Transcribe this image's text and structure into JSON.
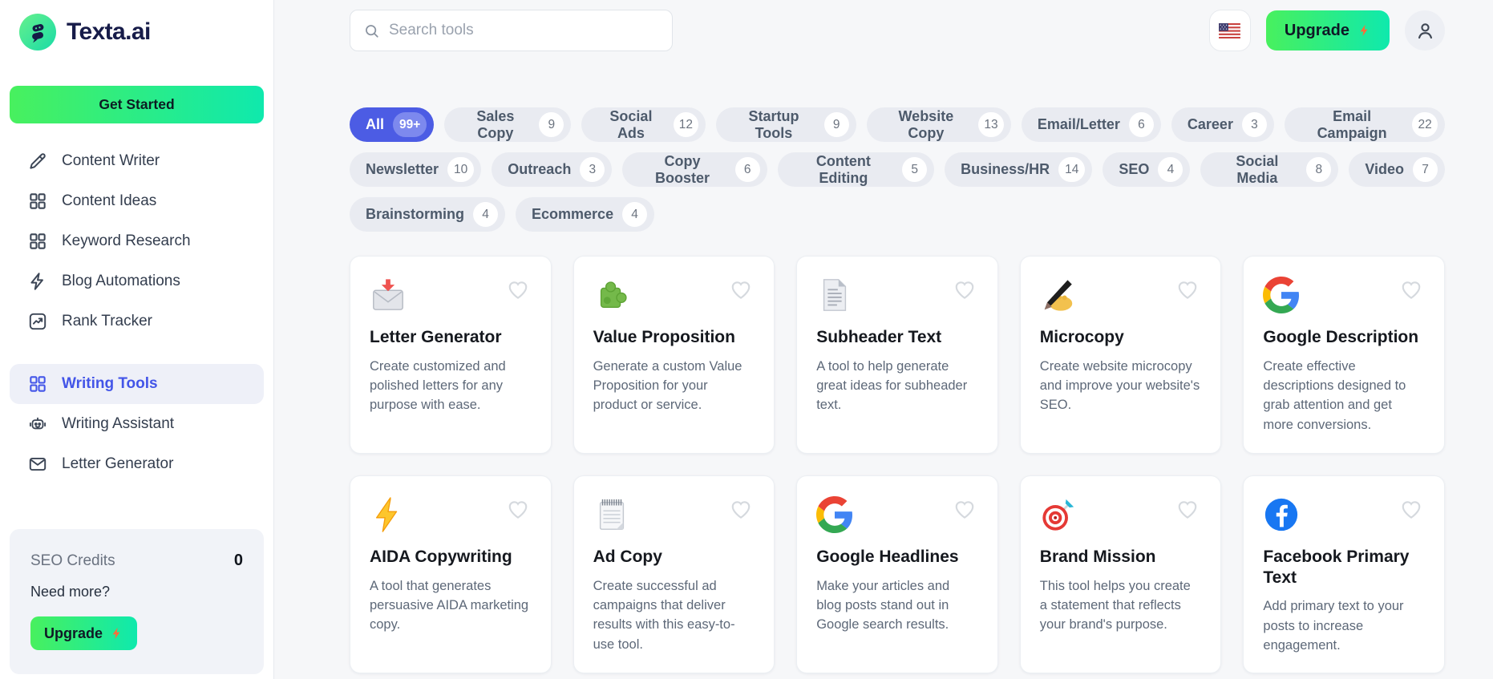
{
  "brand": {
    "name": "Texta.ai",
    "logo_icon": "chat-bubbles-icon"
  },
  "colors": {
    "accent_gradient_start": "#48f05e",
    "accent_gradient_end": "#0fe9ad",
    "active_indigo": "#4c5ce4",
    "bolt_orange": "#fb6d3a",
    "sidebar_active_bg": "#eef0f8",
    "pill_bg": "#e9ebf1",
    "main_bg": "#f6f7f9"
  },
  "sidebar": {
    "get_started_label": "Get Started",
    "items": [
      {
        "label": "Content Writer",
        "icon": "pencil-icon",
        "active": false,
        "group_start": false
      },
      {
        "label": "Content Ideas",
        "icon": "grid-icon",
        "active": false,
        "group_start": false
      },
      {
        "label": "Keyword Research",
        "icon": "grid-icon",
        "active": false,
        "group_start": false
      },
      {
        "label": "Blog Automations",
        "icon": "bolt-outline-icon",
        "active": false,
        "group_start": false
      },
      {
        "label": "Rank Tracker",
        "icon": "chart-icon",
        "active": false,
        "group_start": false
      },
      {
        "label": "Writing Tools",
        "icon": "grid-icon",
        "active": true,
        "group_start": true
      },
      {
        "label": "Writing Assistant",
        "icon": "robot-icon",
        "active": false,
        "group_start": false
      },
      {
        "label": "Letter Generator",
        "icon": "envelope-icon",
        "active": false,
        "group_start": false
      }
    ],
    "credits": {
      "label": "SEO Credits",
      "value": "0",
      "need_more": "Need more?",
      "upgrade_label": "Upgrade",
      "upgrade_icon": "bolt-fill-icon"
    }
  },
  "header": {
    "search_placeholder": "Search tools",
    "search_icon": "search-icon",
    "language_icon": "us-flag-icon",
    "upgrade_label": "Upgrade",
    "upgrade_icon": "bolt-fill-icon",
    "avatar_icon": "user-icon"
  },
  "filters": {
    "rows": [
      [
        {
          "label": "All",
          "count": "99+",
          "active": true
        },
        {
          "label": "Sales Copy",
          "count": "9",
          "active": false
        },
        {
          "label": "Social Ads",
          "count": "12",
          "active": false
        },
        {
          "label": "Startup Tools",
          "count": "9",
          "active": false
        },
        {
          "label": "Website Copy",
          "count": "13",
          "active": false
        },
        {
          "label": "Email/Letter",
          "count": "6",
          "active": false
        },
        {
          "label": "Career",
          "count": "3",
          "active": false
        },
        {
          "label": "Email Campaign",
          "count": "22",
          "active": false
        }
      ],
      [
        {
          "label": "Newsletter",
          "count": "10",
          "active": false
        },
        {
          "label": "Outreach",
          "count": "3",
          "active": false
        },
        {
          "label": "Copy Booster",
          "count": "6",
          "active": false
        },
        {
          "label": "Content Editing",
          "count": "5",
          "active": false
        },
        {
          "label": "Business/HR",
          "count": "14",
          "active": false
        },
        {
          "label": "SEO",
          "count": "4",
          "active": false
        },
        {
          "label": "Social Media",
          "count": "8",
          "active": false
        },
        {
          "label": "Video",
          "count": "7",
          "active": false
        }
      ],
      [
        {
          "label": "Brainstorming",
          "count": "4",
          "active": false
        },
        {
          "label": "Ecommerce",
          "count": "4",
          "active": false
        }
      ]
    ]
  },
  "cards": [
    {
      "title": "Letter Generator",
      "icon": "mail-incoming-icon",
      "description": "Create customized and polished letters for any purpose with ease."
    },
    {
      "title": "Value Proposition",
      "icon": "puzzle-icon",
      "description": "Generate a custom Value Proposition for your product or service."
    },
    {
      "title": "Subheader Text",
      "icon": "document-icon",
      "description": "A tool to help generate great ideas for subheader text."
    },
    {
      "title": "Microcopy",
      "icon": "writing-hand-icon",
      "description": "Create website microcopy and improve your website's SEO."
    },
    {
      "title": "Google Description",
      "icon": "google-icon",
      "description": "Create effective descriptions designed to grab attention and get more conversions."
    },
    {
      "title": "AIDA Copywriting",
      "icon": "lightning-icon",
      "description": "A tool that generates persuasive AIDA marketing copy."
    },
    {
      "title": "Ad Copy",
      "icon": "notepad-icon",
      "description": "Create successful ad campaigns that deliver results with this easy-to-use tool."
    },
    {
      "title": "Google Headlines",
      "icon": "google-icon",
      "description": "Make your articles and blog posts stand out in Google search results."
    },
    {
      "title": "Brand Mission",
      "icon": "target-icon",
      "description": "This tool helps you create a statement that reflects your brand's purpose."
    },
    {
      "title": "Facebook Primary Text",
      "icon": "facebook-icon",
      "description": "Add primary text to your posts to increase engagement."
    }
  ]
}
